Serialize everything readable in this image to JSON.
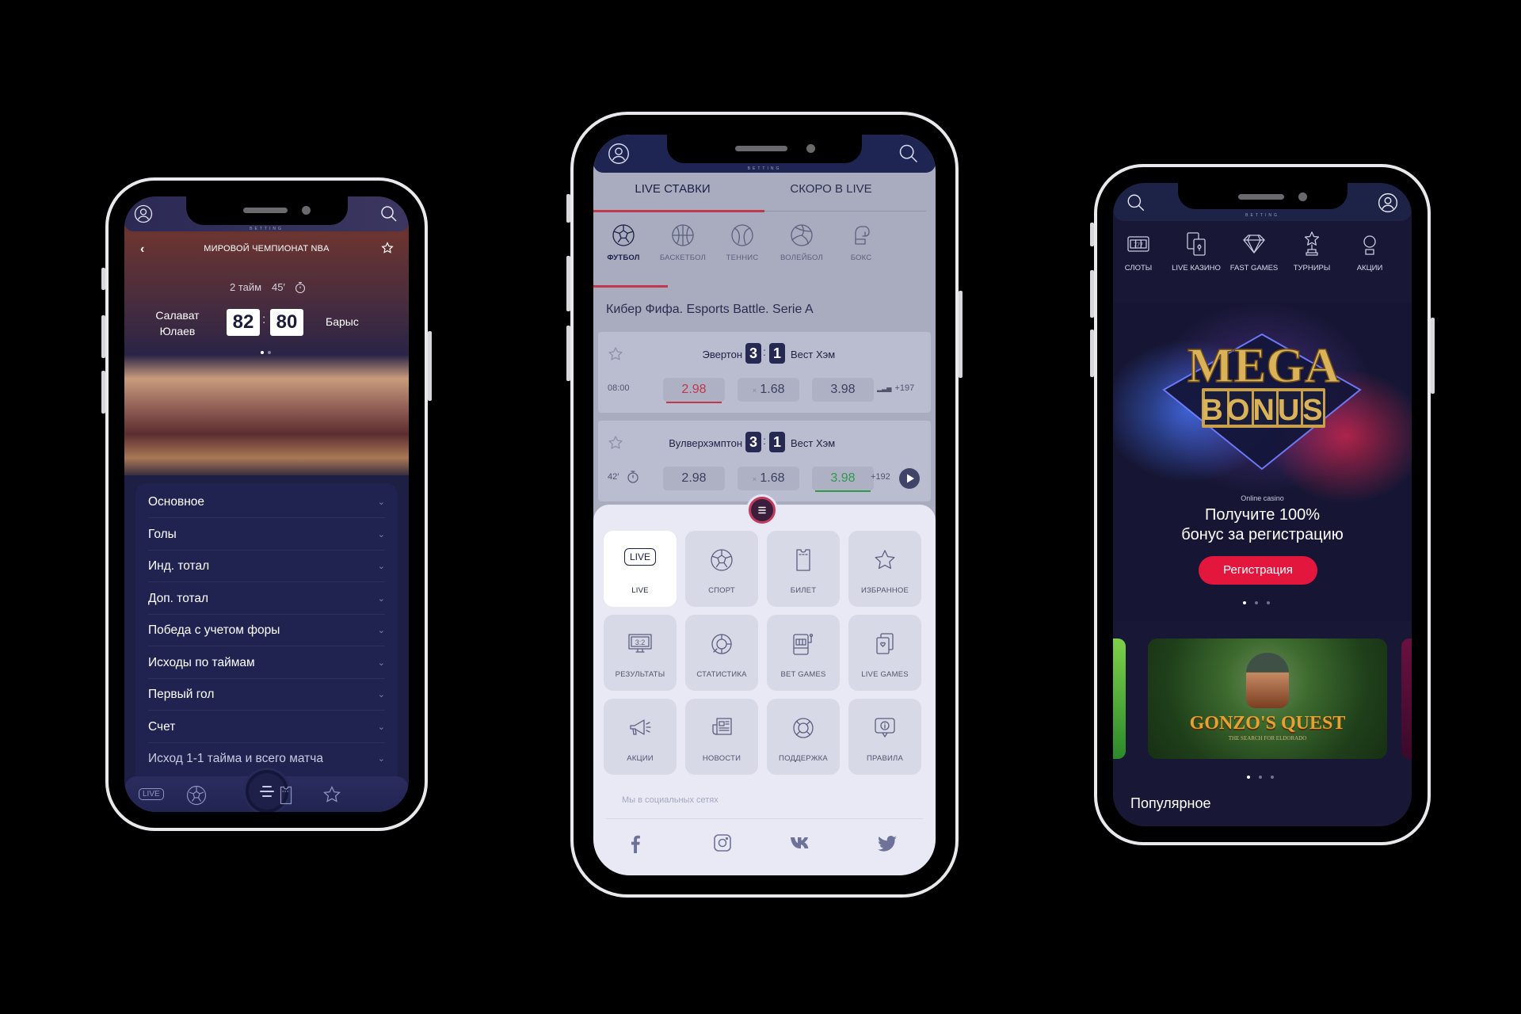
{
  "brand_tag": "BETTING",
  "left_phone": {
    "header": {
      "title": "МИРОВОЙ ЧЕМПИОНАТ NBA"
    },
    "match": {
      "period": "2 тайм",
      "minute": "45′",
      "home_team_line1": "Салават",
      "home_team_line2": "Юлаев",
      "away_team": "Барыс",
      "home_score": "82",
      "away_score": "80",
      "separator": ":"
    },
    "markets": [
      {
        "label": "Основное"
      },
      {
        "label": "Голы"
      },
      {
        "label": "Инд. тотал"
      },
      {
        "label": "Доп. тотал"
      },
      {
        "label": "Победа с учетом форы"
      },
      {
        "label": "Исходы по таймам"
      },
      {
        "label": "Первый гол"
      },
      {
        "label": "Счет"
      },
      {
        "label": "Исход 1-1 тайма и всего матча"
      }
    ],
    "bottom_nav": {
      "live_label": "LIVE"
    }
  },
  "middle_phone": {
    "tabs": [
      {
        "label": "LIVE СТАВКИ",
        "active": true
      },
      {
        "label": "СКОРО В LIVE",
        "active": false
      }
    ],
    "sports": [
      {
        "label": "ФУТБОЛ",
        "icon": "soccer-ball-icon",
        "active": true
      },
      {
        "label": "БАСКЕТБОЛ",
        "icon": "basketball-icon",
        "active": false
      },
      {
        "label": "ТЕННИС",
        "icon": "tennis-ball-icon",
        "active": false
      },
      {
        "label": "ВОЛЕЙБОЛ",
        "icon": "volleyball-icon",
        "active": false
      },
      {
        "label": "БОКС",
        "icon": "boxing-glove-icon",
        "active": false
      }
    ],
    "league": "Кибер Фифа. Esports Battle. Serie A",
    "matches": [
      {
        "home": "Эвертон",
        "away": "Вест Хэм",
        "home_score": "3",
        "away_score": "1",
        "time": "08:00",
        "odds": [
          "2.98",
          "1.68",
          "3.98"
        ],
        "draw_prefix": "×",
        "more": "+197",
        "highlight": "home",
        "highlight_color": "#c0384a"
      },
      {
        "home": "Вулверхэмптон",
        "away": "Вест Хэм",
        "home_score": "3",
        "away_score": "1",
        "time": "42′",
        "odds": [
          "2.98",
          "1.68",
          "3.98"
        ],
        "draw_prefix": "×",
        "more": "+192",
        "highlight": "away",
        "highlight_color": "#2e9a4a"
      }
    ],
    "menu": [
      {
        "label": "LIVE",
        "icon": "live-badge-icon",
        "active": true
      },
      {
        "label": "СПОРТ",
        "icon": "soccer-ball-icon"
      },
      {
        "label": "БИЛЕТ",
        "icon": "ticket-icon"
      },
      {
        "label": "ИЗБРАННОЕ",
        "icon": "star-icon"
      },
      {
        "label": "РЕЗУЛЬТАТЫ",
        "icon": "scoreboard-icon",
        "icon_text": "3:2"
      },
      {
        "label": "СТАТИСТИКА",
        "icon": "pie-chart-icon"
      },
      {
        "label": "BET GAMES",
        "icon": "slot-machine-icon"
      },
      {
        "label": "LIVE GAMES",
        "icon": "playing-cards-icon"
      },
      {
        "label": "АКЦИИ",
        "icon": "megaphone-icon"
      },
      {
        "label": "НОВОСТИ",
        "icon": "newspaper-icon"
      },
      {
        "label": "ПОДДЕРЖКА",
        "icon": "lifebuoy-icon"
      },
      {
        "label": "ПРАВИЛА",
        "icon": "info-bubble-icon"
      }
    ],
    "social_label": "Мы в социальных сетях",
    "social": [
      "facebook",
      "instagram",
      "vk",
      "twitter"
    ]
  },
  "right_phone": {
    "categories": [
      {
        "label": "СЛОТЫ",
        "icon": "slot-reels-icon",
        "icon_text": "777"
      },
      {
        "label": "LIVE КАЗИНО",
        "icon": "cards-icon"
      },
      {
        "label": "FAST GAMES",
        "icon": "diamond-icon"
      },
      {
        "label": "ТУРНИРЫ",
        "icon": "trophy-icon"
      },
      {
        "label": "АКЦИИ",
        "icon": "promo-icon"
      }
    ],
    "banner": {
      "mega": "MEGA",
      "bonus": "BONUS",
      "eyebrow": "Online casino",
      "headline_line1": "Получите 100%",
      "headline_line2": "бонус за регистрацию",
      "cta": "Регистрация",
      "accent": "#e3173e"
    },
    "game_card": {
      "title": "GONZO'S QUEST",
      "subtitle": "THE SEARCH FOR ELDORADO"
    },
    "section_title": "Популярное"
  }
}
